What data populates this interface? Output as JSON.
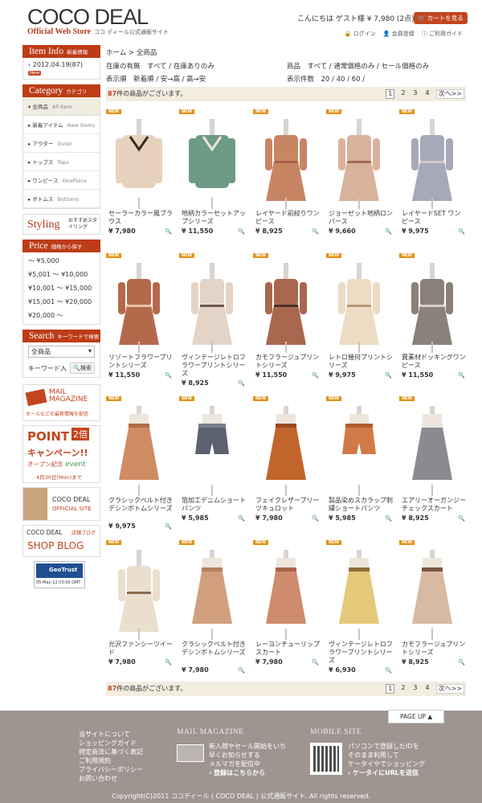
{
  "header": {
    "logo": "COCO DEAL",
    "subtitle": "Official Web Store",
    "subtitle_jp": "ココ ディール公式通販サイト",
    "greeting": "こんにちは ゲスト様 ¥ 7,980 (2点)",
    "cart_label": "カートを見る",
    "links": [
      "ログイン",
      "会員登録",
      "ご利用ガイド"
    ]
  },
  "sidebar": {
    "item_info_title": "Item Info",
    "item_info_sub": "新着情報",
    "item_info_entry": "2012.04.19(87)",
    "item_info_badge": "New",
    "category_title": "Category",
    "category_sub": "カテゴリ",
    "categories": [
      {
        "jp": "全商品",
        "en": "All Item"
      },
      {
        "jp": "新着アイテム",
        "en": "New Items"
      },
      {
        "jp": "アウター",
        "en": "Outer"
      },
      {
        "jp": "トップス",
        "en": "Tops"
      },
      {
        "jp": "ワンピース",
        "en": "OnePiece"
      },
      {
        "jp": "ボトムス",
        "en": "Bottoms"
      }
    ],
    "styling_title": "Styling",
    "styling_sub": "おすすめスタイリング",
    "price_title": "Price",
    "price_sub": "価格から探す",
    "prices": [
      "～ ¥5,000",
      "¥5,001 ～ ¥10,000",
      "¥10,001 ～ ¥15,000",
      "¥15,001 ～ ¥20,000",
      "¥20,000 ～"
    ],
    "search_title": "Search",
    "search_sub": "キーワードで検索",
    "search_select": "全商品",
    "keyword_label": "キーワード入",
    "search_button": "検索",
    "mail_banner": "MAIL MAGAZINE",
    "mail_banner_sub": "セールなどの最新情報を配信",
    "point_banner": "POINT",
    "point_banner_x": "2倍",
    "point_banner2": "キャンペーン!!",
    "point_banner3": "オープン記念",
    "point_banner3b": "event",
    "point_banner4": "4月30日(Mon)まで",
    "official_banner": "COCO DEAL",
    "official_banner_sub": "OFFICIAL SITE",
    "blog_banner": "COCO DEAL",
    "blog_banner_tag": "店舗ブログ",
    "blog_banner_sub": "SHOP BLOG",
    "geotrust": "GeoTrust",
    "geotrust_date": "05-May-12 03:00 GMT"
  },
  "main": {
    "breadcrumb": "ホーム > 全商品",
    "filter_stock": "在庫の有無　すべて / 在庫ありのみ",
    "filter_goods": "商品　すべて / 通常価格のみ / セール価格のみ",
    "sort_order": "表示順　新着順 / 安→高 / 高→安",
    "per_page": "表示件数　20 / 40 / 60 /",
    "count_num": "87",
    "count_text": "件の商品がございます。",
    "pages": [
      "1",
      "2",
      "3",
      "4",
      "次へ>>"
    ],
    "new_label": "NEW",
    "products": [
      {
        "name": "セーラーカラー風ブラウス",
        "price": "¥ 7,980",
        "color": "#e7d2bd",
        "accent": "#3a2a22"
      },
      {
        "name": "地柄カラーセットアップシリーズ",
        "price": "¥ 11,550",
        "color": "#6d9a84",
        "accent": "#ece4d5"
      },
      {
        "name": "レイヤード前絞りワンピース",
        "price": "¥ 8,925",
        "color": "#c88564",
        "accent": "#a86346"
      },
      {
        "name": "ジョーゼット地柄ロンパース",
        "price": "¥ 9,660",
        "color": "#d9b29b",
        "accent": "#9c6d55"
      },
      {
        "name": "レイヤードSET ワンピース",
        "price": "¥ 9,975",
        "color": "#a6a9b7",
        "accent": "#d2c9bf"
      },
      {
        "name": "リゾートフラワープリントシリーズ",
        "price": "¥ 11,550",
        "color": "#b5694b",
        "accent": "#e6c4a9"
      },
      {
        "name": "ヴィンテージレトロフラワープリントシリーズ",
        "price": "¥ 8,925",
        "color": "#e4d4c7",
        "accent": "#6d5a50"
      },
      {
        "name": "カモフラージュプリントシリーズ",
        "price": "¥ 11,550",
        "color": "#a8674e",
        "accent": "#4e3228"
      },
      {
        "name": "レトロ幾何プリントシリーズ",
        "price": "¥ 9,975",
        "color": "#ecdcc3",
        "accent": "#b89b7a"
      },
      {
        "name": "異素材ドッキングワンピース",
        "price": "¥ 11,550",
        "color": "#8a8178",
        "accent": "#d8d0c8"
      },
      {
        "name": "クラシックベルト付きデシンボトムシリーズ",
        "price": "¥ 9,975",
        "color": "#cf8c62",
        "accent": "#b06c44"
      },
      {
        "name": "箔加工デニムショートパンツ",
        "price": "¥ 5,985",
        "color": "#5d6271",
        "accent": "#7a8090"
      },
      {
        "name": "フェイクレザープリーツキュロット",
        "price": "¥ 7,980",
        "color": "#c2652c",
        "accent": "#9a4a1f"
      },
      {
        "name": "製品染めスカラップ刺繍ショートパンツ",
        "price": "¥ 5,985",
        "color": "#d17a47",
        "accent": "#b05e30"
      },
      {
        "name": "エアリーオーガンジーチェックスカート",
        "price": "¥ 8,925",
        "color": "#8c8a8f",
        "accent": "#e9e4de"
      },
      {
        "name": "光沢ファンシーツイード",
        "price": "¥ 7,980",
        "color": "#e9dfcc",
        "accent": "#8a6b4f"
      },
      {
        "name": "クラシックベルト付きデシンボトムシリーズ",
        "price": "¥ 7,980",
        "color": "#d29f7e",
        "accent": "#b5825f"
      },
      {
        "name": "レーヨンチューリップスカート",
        "price": "¥ 7,980",
        "color": "#cf8c6c",
        "accent": "#a86348"
      },
      {
        "name": "ヴィンテージレトロフラワープリントシリーズ",
        "price": "¥ 6,930",
        "color": "#e5c97a",
        "accent": "#8f6b3a"
      },
      {
        "name": "カモフラージュプリントシリーズ",
        "price": "¥ 8,925",
        "color": "#d8b9a2",
        "accent": "#7a5640"
      }
    ]
  },
  "footer": {
    "page_up": "PAGE UP ▲",
    "links": [
      "当サイトについて",
      "ショッピングガイド",
      "特定商法に基づく表記",
      "ご利用規約",
      "プライバシーポリシー",
      "お問い合わせ"
    ],
    "mail_title": "MAIL MAGAZINE",
    "mail_lines": [
      "新入荷やセール開始をいち",
      "早くお知らせする",
      "メルマガを配信中"
    ],
    "mail_register": "› 登録はこちらから",
    "mobile_title": "MOBILE SITE",
    "mobile_lines": [
      "パソコンで登録したIDを",
      "そのまま利用して",
      "ケータイやでショッピング"
    ],
    "mobile_send": "› ケータイにURLを送信",
    "copyright": "Copyright(C)2011 ココディール ( COCO DEAL ) 公式通販サイト. All rights reserved."
  }
}
